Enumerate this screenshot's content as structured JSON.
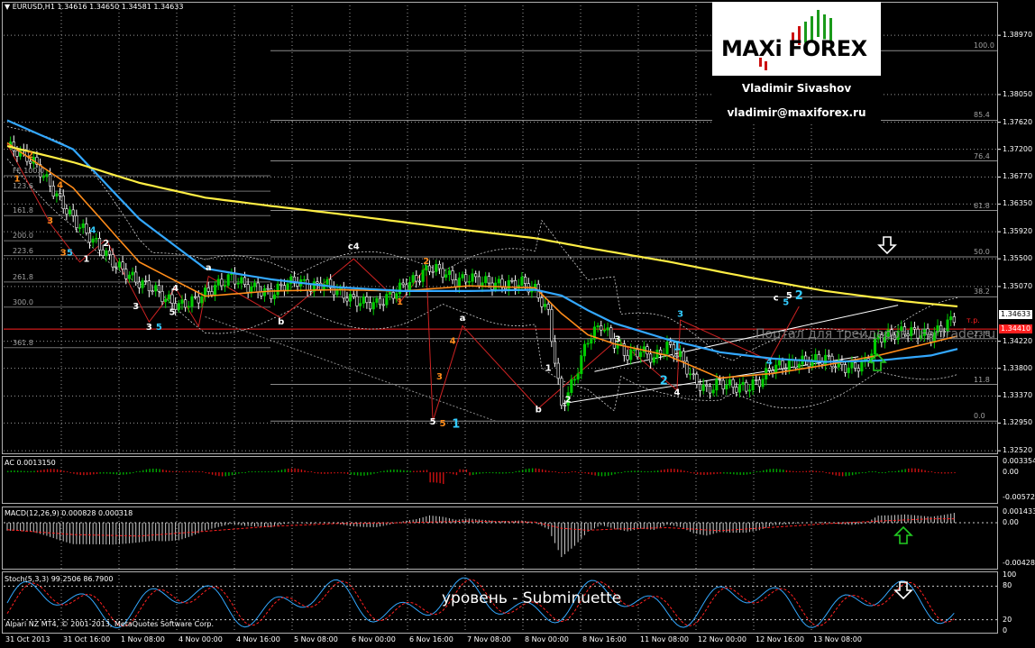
{
  "colors": {
    "background": "#000000",
    "grid": "#9a9a9a",
    "bull_candle": "#00cc00",
    "bear_candle": "#ffffff",
    "ma_fast": "#ff8c1a",
    "ma_mid": "#33a8ff",
    "ma_slow": "#ffee44",
    "resistance": "#ff2020",
    "ac_up": "#00aa00",
    "ac_down": "#cc1111",
    "macd_hist": "#cccccc",
    "macd_signal": "#ff2020",
    "stoch_main": "#33a8ff",
    "stoch_signal": "#ff2020",
    "wave_orange": "#ff8c1a",
    "wave_cyan": "#33ccff",
    "wave_white": "#ffffff",
    "arrow_green": "#22cc22",
    "arrow_white": "#ffffff"
  },
  "header": {
    "symbol_line": "EURUSD,H1  1.34616  1.34650  1.34581  1.34633"
  },
  "logo": {
    "maxi": "MAXi",
    "forex": "FOREX",
    "name": "Vladimir Sivashov",
    "email": "vladimir@maxiforex.ru"
  },
  "caption": "уровень - Subminuette",
  "watermark": "Портал для трейдеров - ForTrader.ru",
  "copyright": "Alpari NZ MT4, © 2001-2013, MetaQuotes Software Corp.",
  "tp_label": "т.р.",
  "chart_data": [
    {
      "type": "line",
      "panel": "price",
      "title": "EURUSD,H1  1.34616  1.34650  1.34581  1.34633",
      "ylim": [
        1.3248,
        1.3935
      ],
      "price_ticks": [
        "1.38970",
        "1.38050",
        "1.37620",
        "1.37200",
        "1.36770",
        "1.36350",
        "1.35920",
        "1.35500",
        "1.35070",
        "1.34633",
        "1.34220",
        "1.33800",
        "1.33370",
        "1.32950",
        "1.32520"
      ],
      "current_price": 1.34633,
      "current_price_label": "1.34633",
      "resistance_price": 1.3441,
      "resistance_label": "1.34410",
      "x_labels": [
        "31 Oct 2013",
        "31 Oct 16:00",
        "1 Nov 08:00",
        "4 Nov 00:00",
        "4 Nov 16:00",
        "5 Nov 08:00",
        "6 Nov 00:00",
        "6 Nov 16:00",
        "7 Nov 08:00",
        "8 Nov 00:00",
        "8 Nov 16:00",
        "11 Nov 08:00",
        "12 Nov 00:00",
        "12 Nov 16:00",
        "13 Nov 08:00"
      ],
      "fib_levels": [
        {
          "label": "100.0",
          "price": 1.3873
        },
        {
          "label": "85.4",
          "price": 1.3765
        },
        {
          "label": "76.4",
          "price": 1.3702
        },
        {
          "label": "61.8",
          "price": 1.3625
        },
        {
          "label": "50.0",
          "price": 1.3553
        },
        {
          "label": "38.2",
          "price": 1.3491
        },
        {
          "label": "23.6",
          "price": 1.3426
        },
        {
          "label": "11.8",
          "price": 1.3355
        },
        {
          "label": "0.0",
          "price": 1.3298
        }
      ],
      "fib_left_labels": [
        {
          "label": "FE 100.0",
          "price": 1.3679
        },
        {
          "label": "123.6",
          "price": 1.3655
        },
        {
          "label": "161.8",
          "price": 1.3617
        },
        {
          "label": "200.0",
          "price": 1.3578
        },
        {
          "label": "223.6",
          "price": 1.3555
        },
        {
          "label": "261.8",
          "price": 1.3514
        },
        {
          "label": "300.0",
          "price": 1.3475
        },
        {
          "label": "361.8",
          "price": 1.3412
        }
      ],
      "series": [
        {
          "name": "Close",
          "x": [
            0,
            4,
            8,
            12,
            16,
            20,
            24,
            28,
            32,
            36,
            40,
            44,
            48,
            52,
            56,
            60,
            64,
            68,
            72,
            76,
            80,
            84,
            88,
            92,
            96,
            100,
            104,
            108,
            112,
            116,
            120,
            124,
            128,
            132,
            136,
            140,
            144,
            148,
            152,
            156,
            160,
            164,
            168,
            172,
            176,
            180,
            184,
            188,
            192,
            196,
            200,
            204,
            208,
            212,
            216,
            220,
            224,
            228,
            232,
            236,
            240,
            244,
            248,
            252,
            256,
            260,
            264,
            268,
            272,
            276,
            280,
            284,
            288
          ],
          "y": [
            1.3725,
            1.3715,
            1.37,
            1.3672,
            1.364,
            1.3612,
            1.359,
            1.3568,
            1.3545,
            1.3528,
            1.3513,
            1.3505,
            1.3488,
            1.3477,
            1.3484,
            1.3496,
            1.351,
            1.3522,
            1.3509,
            1.3502,
            1.3495,
            1.351,
            1.3516,
            1.3505,
            1.3512,
            1.35,
            1.3488,
            1.3482,
            1.348,
            1.3492,
            1.3508,
            1.3518,
            1.3537,
            1.353,
            1.3515,
            1.3521,
            1.3515,
            1.351,
            1.351,
            1.3513,
            1.3502,
            1.3465,
            1.332,
            1.3365,
            1.3425,
            1.3448,
            1.342,
            1.34,
            1.3408,
            1.3395,
            1.3415,
            1.3398,
            1.3362,
            1.3345,
            1.3358,
            1.3352,
            1.335,
            1.336,
            1.3382,
            1.3385,
            1.339,
            1.3392,
            1.3395,
            1.3384,
            1.338,
            1.3388,
            1.3428,
            1.3432,
            1.3438,
            1.3435,
            1.343,
            1.3445,
            1.3463
          ]
        },
        {
          "name": "EMA fast",
          "x": [
            0,
            20,
            40,
            60,
            80,
            100,
            120,
            140,
            160,
            168,
            176,
            184,
            200,
            216,
            232,
            248,
            264,
            280,
            288
          ],
          "y": [
            1.373,
            1.366,
            1.3545,
            1.3492,
            1.35,
            1.3502,
            1.35,
            1.3508,
            1.3505,
            1.3465,
            1.3432,
            1.3418,
            1.34,
            1.3365,
            1.3372,
            1.3385,
            1.34,
            1.342,
            1.343
          ]
        },
        {
          "name": "EMA mid",
          "x": [
            0,
            20,
            40,
            60,
            80,
            100,
            120,
            140,
            160,
            168,
            176,
            184,
            200,
            216,
            232,
            248,
            264,
            280,
            288
          ],
          "y": [
            1.3765,
            1.372,
            1.3612,
            1.3535,
            1.3518,
            1.3506,
            1.35,
            1.35,
            1.3502,
            1.3493,
            1.347,
            1.345,
            1.3425,
            1.3405,
            1.3395,
            1.339,
            1.3392,
            1.34,
            1.341
          ]
        },
        {
          "name": "SMA slow",
          "x": [
            0,
            20,
            40,
            60,
            80,
            100,
            120,
            140,
            160,
            176,
            200,
            224,
            248,
            272,
            288
          ],
          "y": [
            1.3725,
            1.37,
            1.3668,
            1.3645,
            1.3632,
            1.362,
            1.3607,
            1.3594,
            1.3582,
            1.3567,
            1.3546,
            1.3522,
            1.35,
            1.3484,
            1.3476
          ]
        }
      ],
      "wave_labels": [
        {
          "text": "1",
          "color": "#ff8c1a",
          "x": 3,
          "price": 1.367
        },
        {
          "text": "2",
          "color": "#ff8c1a",
          "x": 7,
          "price": 1.3707
        },
        {
          "text": "3",
          "color": "#ff8c1a",
          "x": 13,
          "price": 1.3605
        },
        {
          "text": "4",
          "color": "#ff8c1a",
          "x": 16,
          "price": 1.366
        },
        {
          "text": "3",
          "color": "#ff8c1a",
          "x": 17,
          "price": 1.3555
        },
        {
          "text": "5",
          "color": "#33ccff",
          "x": 19,
          "price": 1.3555
        },
        {
          "text": "4",
          "color": "#33ccff",
          "x": 26,
          "price": 1.359
        },
        {
          "text": "1",
          "color": "#ffffff",
          "x": 24,
          "price": 1.3545
        },
        {
          "text": "2",
          "color": "#ffffff",
          "x": 30,
          "price": 1.357
        },
        {
          "text": "3",
          "color": "#ffffff",
          "x": 39,
          "price": 1.3472
        },
        {
          "text": "4",
          "color": "#ffffff",
          "x": 51,
          "price": 1.35
        },
        {
          "text": "5",
          "color": "#ffffff",
          "x": 50,
          "price": 1.3463
        },
        {
          "text": "3",
          "color": "#ffffff",
          "x": 43,
          "price": 1.344
        },
        {
          "text": "5",
          "color": "#33ccff",
          "x": 46,
          "price": 1.344
        },
        {
          "text": "a",
          "color": "#ffffff",
          "x": 61,
          "price": 1.3532
        },
        {
          "text": "b",
          "color": "#ffffff",
          "x": 83,
          "price": 1.3448
        },
        {
          "text": "c4",
          "color": "#ffffff",
          "x": 105,
          "price": 1.3565
        },
        {
          "text": "2",
          "color": "#ff8c1a",
          "x": 127,
          "price": 1.3542
        },
        {
          "text": "1",
          "color": "#ff8c1a",
          "x": 119,
          "price": 1.3479
        },
        {
          "text": "4",
          "color": "#ff8c1a",
          "x": 135,
          "price": 1.3418
        },
        {
          "text": "3",
          "color": "#ff8c1a",
          "x": 131,
          "price": 1.3363
        },
        {
          "text": "5",
          "color": "#ffffff",
          "x": 129,
          "price": 1.3293
        },
        {
          "text": "5",
          "color": "#ff8c1a",
          "x": 132,
          "price": 1.329
        },
        {
          "text": "1",
          "color": "#33ccff",
          "x": 136,
          "price": 1.3288
        },
        {
          "text": "a",
          "color": "#ffffff",
          "x": 138,
          "price": 1.3454
        },
        {
          "text": "b",
          "color": "#ffffff",
          "x": 161,
          "price": 1.3312
        },
        {
          "text": "1",
          "color": "#ffffff",
          "x": 164,
          "price": 1.3376
        },
        {
          "text": "2",
          "color": "#ffffff",
          "x": 170,
          "price": 1.3327
        },
        {
          "text": "3",
          "color": "#ffffff",
          "x": 185,
          "price": 1.3421
        },
        {
          "text": "4",
          "color": "#ffffff",
          "x": 203,
          "price": 1.3338
        },
        {
          "text": "1",
          "color": "#33ccff",
          "x": 203,
          "price": 1.3408
        },
        {
          "text": "2",
          "color": "#33ccff",
          "x": 199,
          "price": 1.3355
        },
        {
          "text": "3",
          "color": "#33ccff",
          "x": 204,
          "price": 1.346
        },
        {
          "text": "4",
          "color": "#33ccff",
          "x": 231,
          "price": 1.3386
        },
        {
          "text": "c",
          "color": "#ffffff",
          "x": 233,
          "price": 1.3485
        },
        {
          "text": "5",
          "color": "#ffffff",
          "x": 237,
          "price": 1.3489
        },
        {
          "text": "5",
          "color": "#33ccff",
          "x": 236,
          "price": 1.3478
        },
        {
          "text": "2",
          "color": "#33ccff",
          "x": 240,
          "price": 1.3487
        }
      ]
    },
    {
      "type": "bar",
      "panel": "AC",
      "title": "AC 0.0013150",
      "ticks": [
        "0.003354",
        "0.00",
        "-0.005728"
      ]
    },
    {
      "type": "bar",
      "panel": "MACD",
      "title": "MACD(12,26,9) 0.000828 0.000318",
      "ticks": [
        "0.001433",
        "0.00",
        "-0.004289"
      ]
    },
    {
      "type": "line",
      "panel": "Stoch",
      "title": "Stoch(5,3,3) 99.2506 86.7900",
      "ticks": [
        "100",
        "80",
        "20",
        "0"
      ]
    }
  ]
}
